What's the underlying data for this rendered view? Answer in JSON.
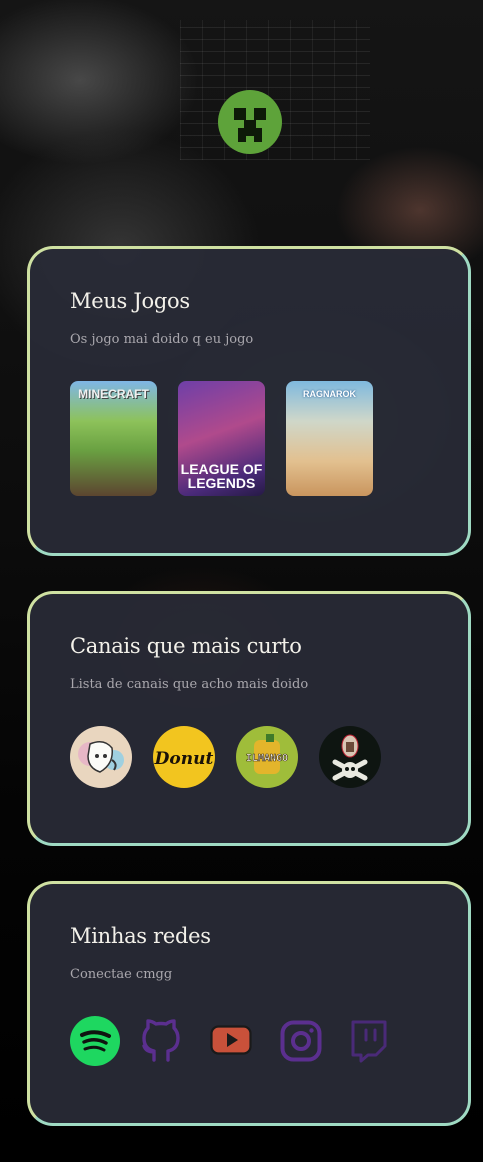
{
  "sections": {
    "games": {
      "title": "Meus Jogos",
      "subtitle": "Os jogo mai doido q eu jogo",
      "items": [
        {
          "name": "Minecraft",
          "cover_text": "MINECRAFT"
        },
        {
          "name": "League of Legends",
          "cover_text": "LEAGUE OF LEGENDS"
        },
        {
          "name": "Ragnarok",
          "cover_text": "RAGNAROK"
        }
      ]
    },
    "channels": {
      "title": "Canais que mais curto",
      "subtitle": "Lista de canais que acho mais doido",
      "items": [
        {
          "name": "channel-mask-avatar"
        },
        {
          "name": "Donut",
          "logo_text": "Donut"
        },
        {
          "name": "IL MANGO",
          "logo_text": "ILMANGO"
        },
        {
          "name": "channel-skull-avatar"
        }
      ]
    },
    "socials": {
      "title": "Minhas redes",
      "subtitle": "Conectae cmgg",
      "items": [
        {
          "name": "spotify-icon",
          "color": "#1ed760"
        },
        {
          "name": "github-icon",
          "color": "#5b2f8f"
        },
        {
          "name": "youtube-icon",
          "color": "#c9513a"
        },
        {
          "name": "instagram-icon",
          "color": "#5b2f8f"
        },
        {
          "name": "twitch-icon",
          "color": "#4a2a78"
        }
      ]
    }
  },
  "colors": {
    "card_bg": "#282b36",
    "card_border_start": "#cfe1a2",
    "card_border_end": "#9fdac3",
    "title": "#f3f1ea",
    "subtitle": "#a9a7ad"
  }
}
